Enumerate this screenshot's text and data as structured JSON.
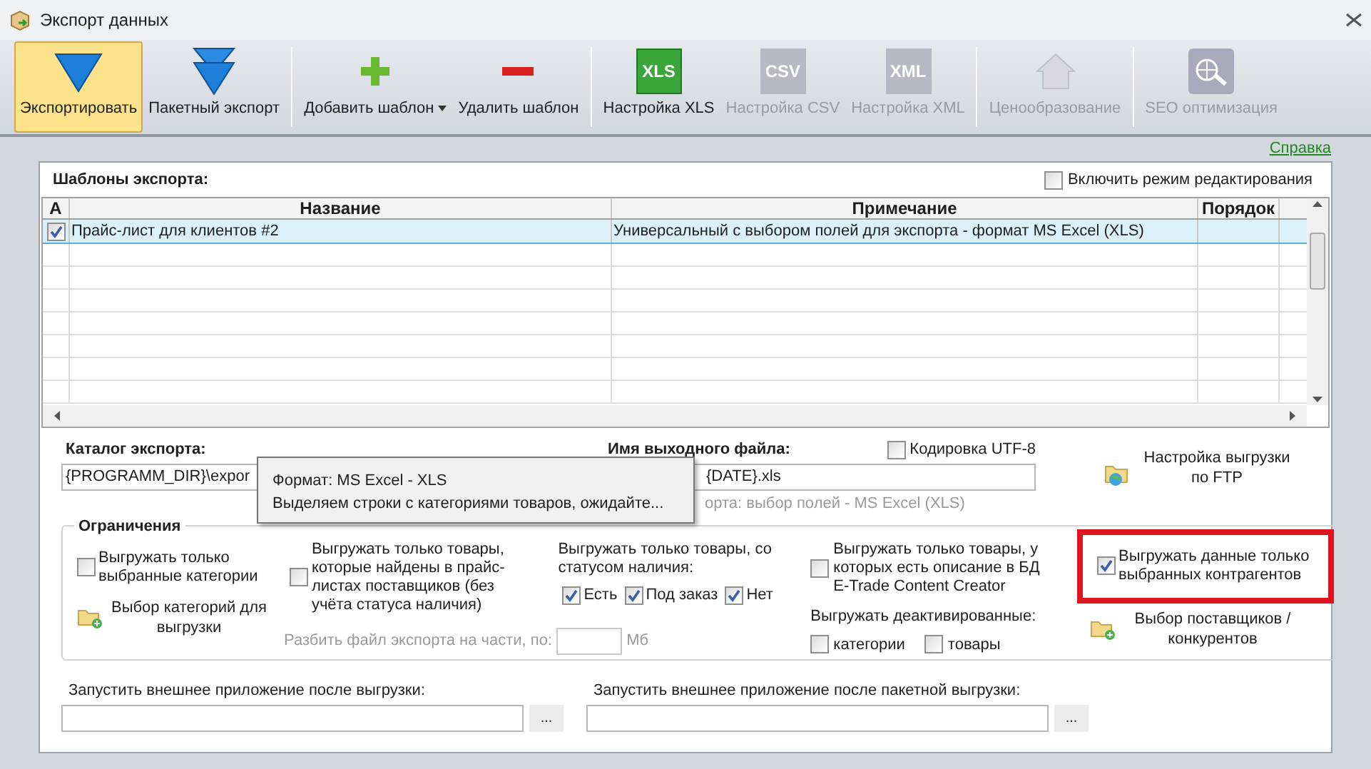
{
  "window": {
    "title": "Экспорт данных"
  },
  "toolbar": [
    {
      "label": "Экспортировать",
      "kind": "export",
      "selected": true,
      "disabled": false
    },
    {
      "label": "Пакетный экспорт",
      "kind": "batch",
      "selected": false,
      "disabled": false
    },
    {
      "label": "Добавить шаблон",
      "kind": "add",
      "selected": false,
      "disabled": false,
      "dropdown": true
    },
    {
      "label": "Удалить шаблон",
      "kind": "remove",
      "selected": false,
      "disabled": false
    },
    {
      "label": "Настройка XLS",
      "kind": "tile",
      "icon_text": "XLS",
      "selected": false,
      "disabled": false
    },
    {
      "label": "Настройка CSV",
      "kind": "tile",
      "icon_text": "CSV",
      "selected": false,
      "disabled": true
    },
    {
      "label": "Настройка XML",
      "kind": "tile",
      "icon_text": "XML",
      "selected": false,
      "disabled": true
    },
    {
      "label": "Ценообразование",
      "kind": "pricing",
      "selected": false,
      "disabled": true
    },
    {
      "label": "SEO оптимизация",
      "kind": "seo",
      "selected": false,
      "disabled": true
    }
  ],
  "help_link": "Справка",
  "templates": {
    "title": "Шаблоны экспорта:",
    "edit_mode": {
      "label": "Включить режим редактирования",
      "checked": false
    },
    "columns": [
      "A",
      "Название",
      "Примечание",
      "Порядок"
    ],
    "rows": [
      {
        "active": true,
        "name": "Прайс-лист для клиентов #2",
        "note": "Универсальный с выбором полей для экспорта - формат MS Excel (XLS)",
        "selected": true
      }
    ]
  },
  "export_folder": {
    "label": "Каталог экспорта:",
    "value": "{PROGRAMM_DIR}\\expor"
  },
  "output_file": {
    "label": "Имя выходного файла:",
    "value": "{DATE}.xls",
    "hint": "орта: выбор полей - MS Excel (XLS)",
    "utf8": {
      "label": "Кодировка UTF-8",
      "checked": false
    }
  },
  "ftp_button": "Настройка выгрузки по FTP",
  "tooltip": {
    "lines": [
      "Формат: MS Excel - XLS",
      "Выделяем строки с категориями товаров, ожидайте..."
    ]
  },
  "restrictions": {
    "title": "Ограничения",
    "selected_categories": {
      "label": "Выгружать только выбранные категории",
      "checked": false
    },
    "category_button": "Выбор категорий для выгрузки",
    "in_price_lists": {
      "label": "Выгружать только товары, которые найдены в прайс-листах поставщиков (без учёта статуса наличия)",
      "checked": false
    },
    "split": {
      "label": "Разбить файл экспорта на части, по:",
      "unit": "Мб",
      "disabled": true
    },
    "status": {
      "label": "Выгружать только товары, со статусом наличия:",
      "options": [
        {
          "label": "Есть",
          "checked": true
        },
        {
          "label": "Под заказ",
          "checked": true
        },
        {
          "label": "Нет",
          "checked": true
        }
      ]
    },
    "with_description": {
      "label": "Выгружать только товары, у которых есть описание в БД E-Trade Content Creator",
      "checked": false
    },
    "deactivated": {
      "label": "Выгружать деактивированные:",
      "options": [
        {
          "label": "категории",
          "checked": false
        },
        {
          "label": "товары",
          "checked": false
        }
      ]
    },
    "selected_contractors": {
      "label": "Выгружать данные только выбранных контрагентов",
      "checked": true,
      "highlighted": true
    },
    "suppliers_button": "Выбор поставщиков / конкурентов"
  },
  "run_after": [
    {
      "label": "Запустить внешнее приложение после выгрузки:",
      "button": "..."
    },
    {
      "label": "Запустить внешнее приложение после пакетной выгрузки:",
      "button": "..."
    }
  ]
}
